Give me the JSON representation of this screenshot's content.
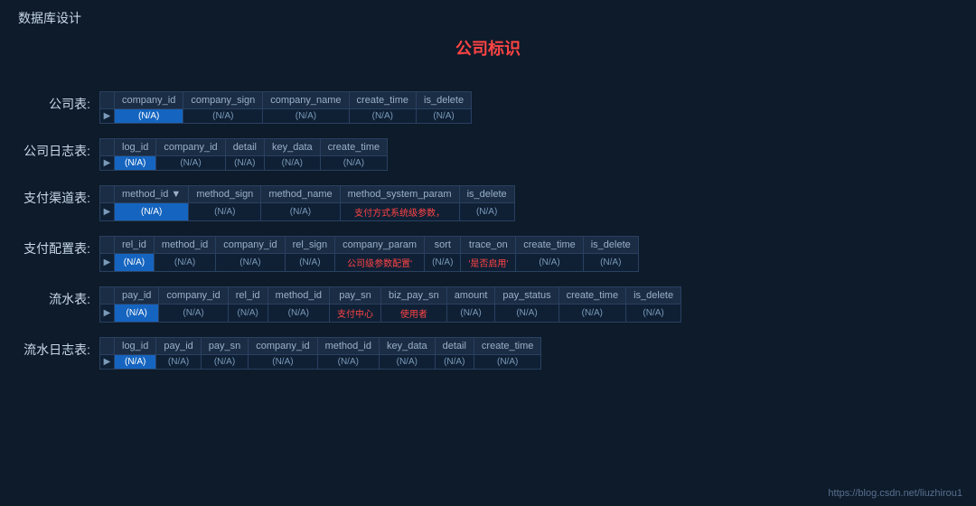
{
  "page": {
    "title": "数据库设计",
    "main_label": "公司标识",
    "footer_url": "https://blog.csdn.net/liuzhirou1"
  },
  "tables": [
    {
      "label": "公司表:",
      "columns": [
        "company_id",
        "company_sign",
        "company_name",
        "create_time",
        "is_delete"
      ],
      "row": [
        "(N/A)",
        "(N/A)",
        "(N/A)",
        "(N/A)",
        "(N/A)"
      ],
      "highlight_col": 0,
      "red_cols": [],
      "has_arrow_header": false
    },
    {
      "label": "公司日志表:",
      "columns": [
        "log_id",
        "company_id",
        "detail",
        "key_data",
        "create_time"
      ],
      "row": [
        "(N/A)",
        "(N/A)",
        "(N/A)",
        "(N/A)",
        "(N/A)"
      ],
      "highlight_col": 0,
      "red_cols": [],
      "has_arrow_header": false
    },
    {
      "label": "支付渠道表:",
      "columns": [
        "method_id",
        "method_sign",
        "method_name",
        "method_system_param",
        "is_delete"
      ],
      "row": [
        "(N/A)",
        "(N/A)",
        "(N/A)",
        "支付方式系统级参数，",
        "(N/A)"
      ],
      "highlight_col": 0,
      "red_cols": [
        3
      ],
      "has_arrow_header": true,
      "arrow_col": 0
    },
    {
      "label": "支付配置表:",
      "columns": [
        "rel_id",
        "method_id",
        "company_id",
        "rel_sign",
        "company_param",
        "sort",
        "trace_on",
        "create_time",
        "is_delete"
      ],
      "row": [
        "(N/A)",
        "(N/A)",
        "(N/A)",
        "(N/A)",
        "公司级参数配置'",
        "(N/A)",
        "'是否启用'",
        "(N/A)",
        "(N/A)"
      ],
      "highlight_col": 0,
      "red_cols": [
        4,
        6
      ],
      "has_arrow_header": false
    },
    {
      "label": "流水表:",
      "columns": [
        "pay_id",
        "company_id",
        "rel_id",
        "method_id",
        "pay_sn",
        "biz_pay_sn",
        "amount",
        "pay_status",
        "create_time",
        "is_delete"
      ],
      "row": [
        "(N/A)",
        "(N/A)",
        "(N/A)",
        "(N/A)",
        "支付中心",
        "使用者",
        "(N/A)",
        "(N/A)",
        "(N/A)",
        "(N/A)"
      ],
      "highlight_col": 0,
      "red_cols": [
        4,
        5
      ],
      "has_arrow_header": false
    },
    {
      "label": "流水日志表:",
      "columns": [
        "log_id",
        "pay_id",
        "pay_sn",
        "company_id",
        "method_id",
        "key_data",
        "detail",
        "create_time"
      ],
      "row": [
        "(N/A)",
        "(N/A)",
        "(N/A)",
        "(N/A)",
        "(N/A)",
        "(N/A)",
        "(N/A)",
        "(N/A)"
      ],
      "highlight_col": 0,
      "red_cols": [],
      "has_arrow_header": false
    }
  ]
}
